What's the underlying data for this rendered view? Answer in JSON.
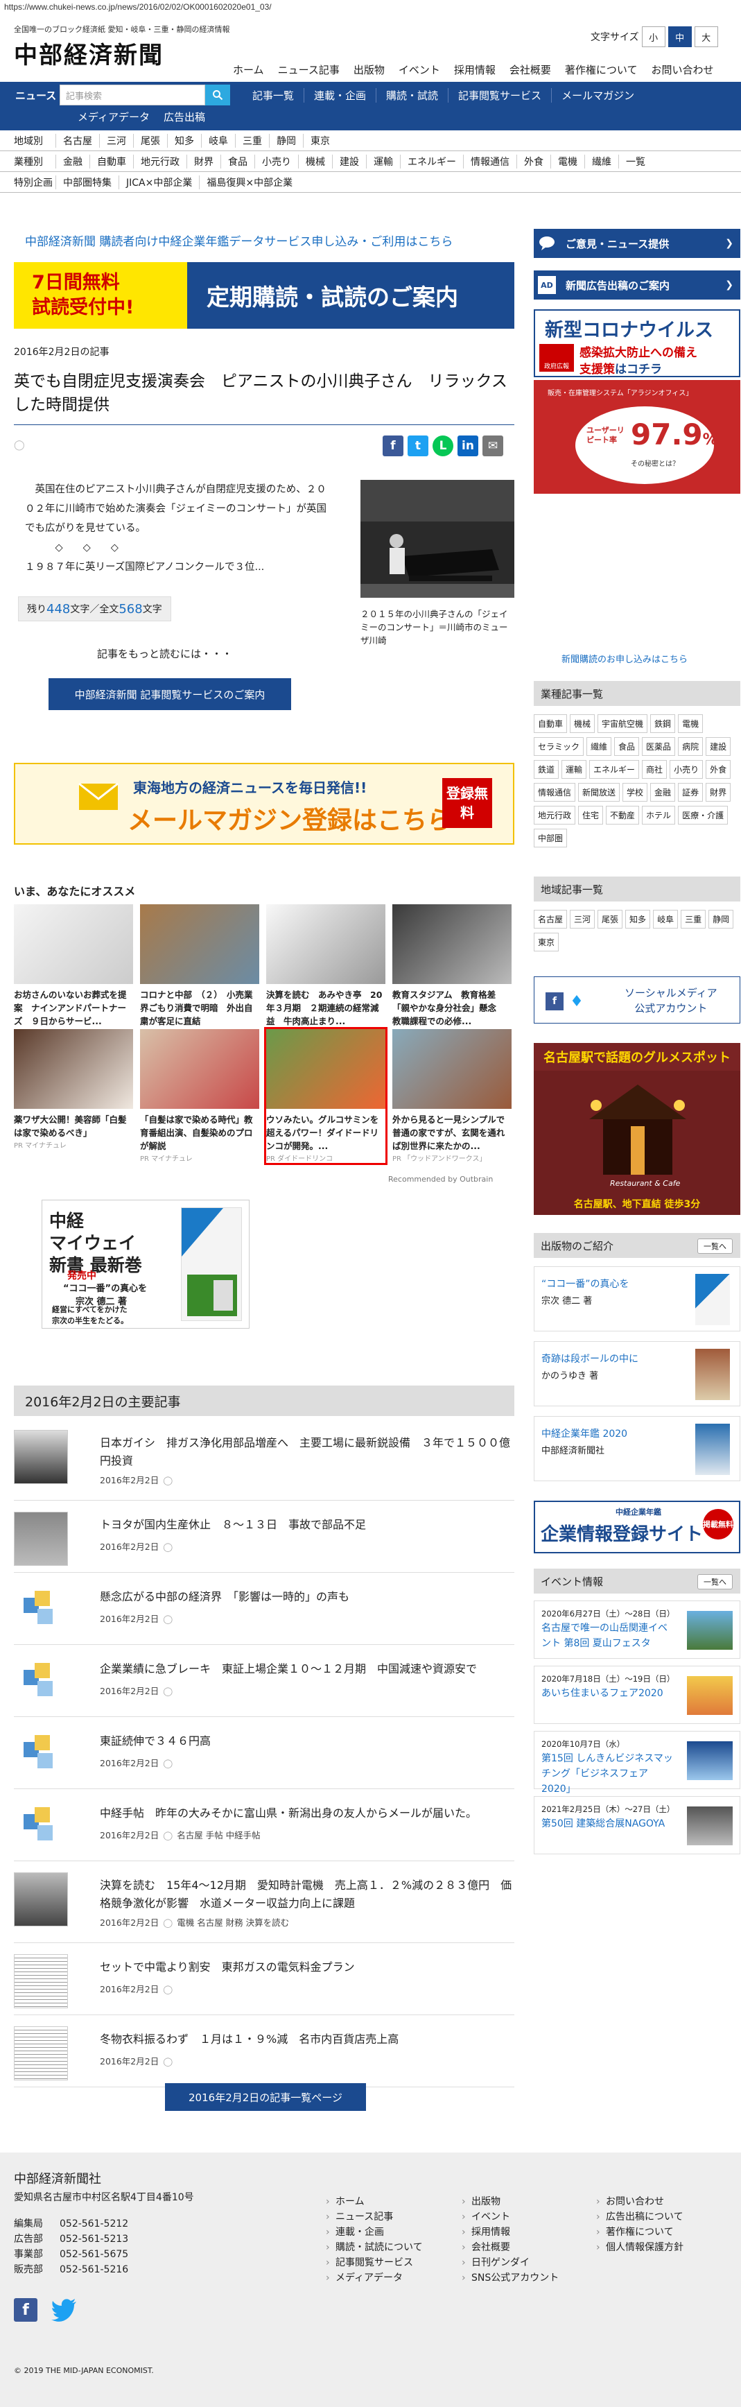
{
  "url": "https://www.chukei-news.co.jp/news/2016/02/02/OK0001602020e01_03/",
  "header": {
    "tagline": "全国唯一のブロック経済紙 愛知・岐阜・三重・静岡の経済情報",
    "logo": "中部経済新聞",
    "font_size_label": "文字サイズ",
    "font_sizes": [
      "小",
      "中",
      "大"
    ],
    "top_nav": [
      "ホーム",
      "ニュース記事",
      "出版物",
      "イベント",
      "採用情報",
      "会社概要",
      "著作権について",
      "お問い合わせ"
    ]
  },
  "blue_nav": {
    "news": "ニュース",
    "search_placeholder": "記事検索",
    "links": [
      "記事一覧",
      "連載・企画",
      "購読・試読",
      "記事閲覧サービス",
      "メールマガジン"
    ],
    "row2": [
      "メディアデータ",
      "広告出稿"
    ]
  },
  "categories": {
    "region_label": "地域別",
    "regions": [
      "名古屋",
      "三河",
      "尾張",
      "知多",
      "岐阜",
      "三重",
      "静岡",
      "東京"
    ],
    "industry_label": "業種別",
    "industries": [
      "金融",
      "自動車",
      "地元行政",
      "財界",
      "食品",
      "小売り",
      "機械",
      "建設",
      "運輸",
      "エネルギー",
      "情報通信",
      "外食",
      "電機",
      "繊維",
      "一覧"
    ],
    "special_label": "特別企画",
    "specials": [
      "中部圏特集",
      "JICA×中部企業",
      "福島復興×中部企業"
    ]
  },
  "main": {
    "promo_link": "中部経済新聞 購読者向け中経企業年鑑データサービス申し込み・ご利用はこちら",
    "trial_banner": {
      "left1": "7日間無料",
      "left2": "試読受付中!",
      "right": "定期購読・試読のご案内"
    },
    "article": {
      "date": "2016年2月2日の記事",
      "title": "英でも自閉症児支援演奏会　ピアニストの小川典子さん　リラックスした時間提供",
      "body1": "英国在住のピアニスト小川典子さんが自閉症児支援のため、２００２年に川崎市で始めた演奏会「ジェイミーのコンサート」が英国でも広がりを見せている。",
      "body2": "◇　　◇　　◇",
      "body3": "１９８７年に英リーズ国際ピアノコンクールで３位...",
      "remaining_pre": "残り",
      "remaining_num": "448",
      "remaining_mid": "文字／全文",
      "remaining_total": "568",
      "remaining_post": "文字",
      "photo_caption": "２０１５年の小川典子さんの「ジェイミーのコンサート」＝川崎市のミューザ川崎",
      "subscribe_link": "新聞購読のお申し込みはこちら",
      "read_more": "記事をもっと読むには・・・",
      "read_more_btn": "中部経済新聞 記事閲覧サービスのご案内"
    },
    "mail_banner": {
      "t1": "東海地方の経済ニュースを毎日発信!!",
      "t2": "メールマガジン登録はこちら",
      "reg": "登録無料"
    },
    "recommend": {
      "title": "いま、あなたにオススメ",
      "items": [
        {
          "caption": "お坊さんのいないお葬式を提案　ナインアンドパートナーズ　９日からサービ...",
          "pr": ""
        },
        {
          "caption": "コロナと中部　（２）　小売業界ごもり消費で明暗　外出自粛が客足に直結",
          "pr": ""
        },
        {
          "caption": "決算を読む　あみやき亭　20年３月期　２期連続の経常減益　牛肉高止まり...",
          "pr": ""
        },
        {
          "caption": "教育スタジアム　教育格差　「親やかな身分社会」懸念　教職課程での必修...",
          "pr": ""
        },
        {
          "caption": "薬ワザ大公開！美容師「白髪は家で染めるべき」",
          "pr": "PR マイナチュレ"
        },
        {
          "caption": "「自髪は家で染める時代」教育番組出演、自髪染めのプロが解説",
          "pr": "PR マイナチュレ"
        },
        {
          "caption": "ウソみたい。グルコサミンを超えるパワー！ダイドードリンコが開発。...",
          "pr": "PR ダイドードリンコ"
        },
        {
          "caption": "外から見ると一見シンプルで普通の家ですが、玄関を通れば別世界に来たかの...",
          "pr": "PR 「ウッドアンドワークス」"
        }
      ],
      "outbrain": "Recommended by Outbrain"
    },
    "book_ad": {
      "t1a": "中経",
      "t1b": "マイウェイ",
      "t1c": "新書 最新巻",
      "t2": "発売中",
      "t3a": "“ココ一番”の真心を",
      "t3b": "宗次 德二 著",
      "t4a": "経営にすべてをかけた",
      "t4b": "宗次の半生をたどる。"
    },
    "top_news": {
      "heading": "2016年2月2日の主要記事",
      "items": [
        {
          "title": "日本ガイシ　排ガス浄化用部品増産へ　主要工場に最新鋭設備　３年で１５００億円投資",
          "date": "2016年2月2日",
          "tags": ""
        },
        {
          "title": "トヨタが国内生産休止　８～１３日　事故で部品不足",
          "date": "2016年2月2日",
          "tags": ""
        },
        {
          "title": "懸念広がる中部の経済界　「影響は一時的」の声も",
          "date": "2016年2月2日",
          "tags": ""
        },
        {
          "title": "企業業績に急ブレーキ　東証上場企業１０～１２月期　中国減速や資源安で",
          "date": "2016年2月2日",
          "tags": ""
        },
        {
          "title": "東証続伸で３４６円高",
          "date": "2016年2月2日",
          "tags": ""
        },
        {
          "title": "中経手帖　昨年の大みそかに富山県・新潟出身の友人からメールが届いた。",
          "date": "2016年2月2日",
          "tags": "名古屋 手帖 中経手帖"
        },
        {
          "title": "決算を読む　15年4～12月期　愛知時計電機　売上高１．２%減の２８３億円　価格競争激化が影響　水道メーター収益力向上に課題",
          "date": "2016年2月2日",
          "tags": "電機 名古屋 財務 決算を読む"
        },
        {
          "title": "セットで中電より割安　東邦ガスの電気料金プラン",
          "date": "2016年2月2日",
          "tags": ""
        },
        {
          "title": "冬物衣料振るわず　１月は１・９%減　名市内百貨店売上高",
          "date": "2016年2月2日",
          "tags": ""
        }
      ],
      "list_btn": "2016年2月2日の記事一覧ページ"
    }
  },
  "sidebar": {
    "opinion_btn": "ご意見・ニュース提供",
    "ad_btn": "新聞広告出稿のご案内",
    "corona": {
      "t1": "新型コロナウイルス",
      "t2a": "感染拡大防止への備え",
      "t2b": "支援策",
      "t2c": "はコチラ",
      "gov": "政府広報"
    },
    "ad2": {
      "t1": "販売・在庫管理システム「アラジンオフィス」",
      "t2": "ユーザーリピート率",
      "num": "97.9",
      "pct": "%",
      "t3": "その秘密とは？"
    },
    "industry_h": "業種記事一覧",
    "industry_tags": [
      "自動車",
      "機械",
      "宇宙航空機",
      "鉄鋼",
      "電機",
      "セラミック",
      "繊維",
      "食品",
      "医薬品",
      "病院",
      "建設",
      "鉄道",
      "運輸",
      "エネルギー",
      "商社",
      "小売り",
      "外食",
      "情報通信",
      "新聞放送",
      "学校",
      "金融",
      "証券",
      "財界",
      "地元行政",
      "住宅",
      "不動産",
      "ホテル",
      "医療・介護",
      "中部圏"
    ],
    "region_h": "地域記事一覧",
    "region_tags": [
      "名古屋",
      "三河",
      "尾張",
      "知多",
      "岐阜",
      "三重",
      "静岡",
      "東京"
    ],
    "social": {
      "t1": "ソーシャルメディア",
      "t2": "公式アカウント"
    },
    "gourmet": {
      "t1": "名古屋駅で話題のグルメスポット",
      "t2": "名古屋駅、地下直結 徒歩3分",
      "t3": "Restaurant & Cafe"
    },
    "pubs_h": "出版物のご紹介",
    "pubs_more": "一覧へ",
    "pubs": [
      {
        "title": "“ココ一番”の真心を",
        "author": "宗次 德二 著"
      },
      {
        "title": "奇跡は段ボールの中に",
        "author": "かのうゆき 著"
      },
      {
        "title": "中経企業年鑑 2020",
        "author": "中部経済新聞社"
      }
    ],
    "reg_banner": {
      "t1": "中経企業年鑑",
      "t2": "企業情報登録サイト",
      "badge": "掲載無料"
    },
    "events_h": "イベント情報",
    "events_more": "一覧へ",
    "events": [
      {
        "date": "2020年6月27日（土）～28日（日）",
        "title": "名古屋で唯一の山岳関連イベント 第8回 夏山フェスタ"
      },
      {
        "date": "2020年7月18日（土）～19日（日）",
        "title": "あいち住まいるフェア2020"
      },
      {
        "date": "2020年10月7日（水）",
        "title": "第15回 しんきんビジネスマッチング「ビジネスフェア2020」"
      },
      {
        "date": "2021年2月25日（木）～27日（土）",
        "title": "第50回 建築総合展NAGOYA"
      }
    ]
  },
  "footer": {
    "name": "中部経済新聞社",
    "addr": "愛知県名古屋市中村区名駅4丁目4番10号",
    "tels": [
      {
        "dept": "編集局",
        "tel": "052-561-5212"
      },
      {
        "dept": "広告部",
        "tel": "052-561-5213"
      },
      {
        "dept": "事業部",
        "tel": "052-561-5675"
      },
      {
        "dept": "販売部",
        "tel": "052-561-5216"
      }
    ],
    "col1": [
      "ホーム",
      "ニュース記事",
      "連載・企画",
      "購読・試読について",
      "記事閲覧サービス",
      "メディアデータ"
    ],
    "col2": [
      "出版物",
      "イベント",
      "採用情報",
      "会社概要",
      "日刊ゲンダイ",
      "SNS公式アカウント"
    ],
    "col3": [
      "お問い合わせ",
      "広告出稿について",
      "著作権について",
      "個人情報保護方針"
    ],
    "copyright": "© 2019 THE MID-JAPAN ECONOMIST."
  },
  "colors": {
    "brand_blue": "#1b4a8f",
    "link_blue": "#1b6fc2",
    "accent_red": "#d10000"
  }
}
